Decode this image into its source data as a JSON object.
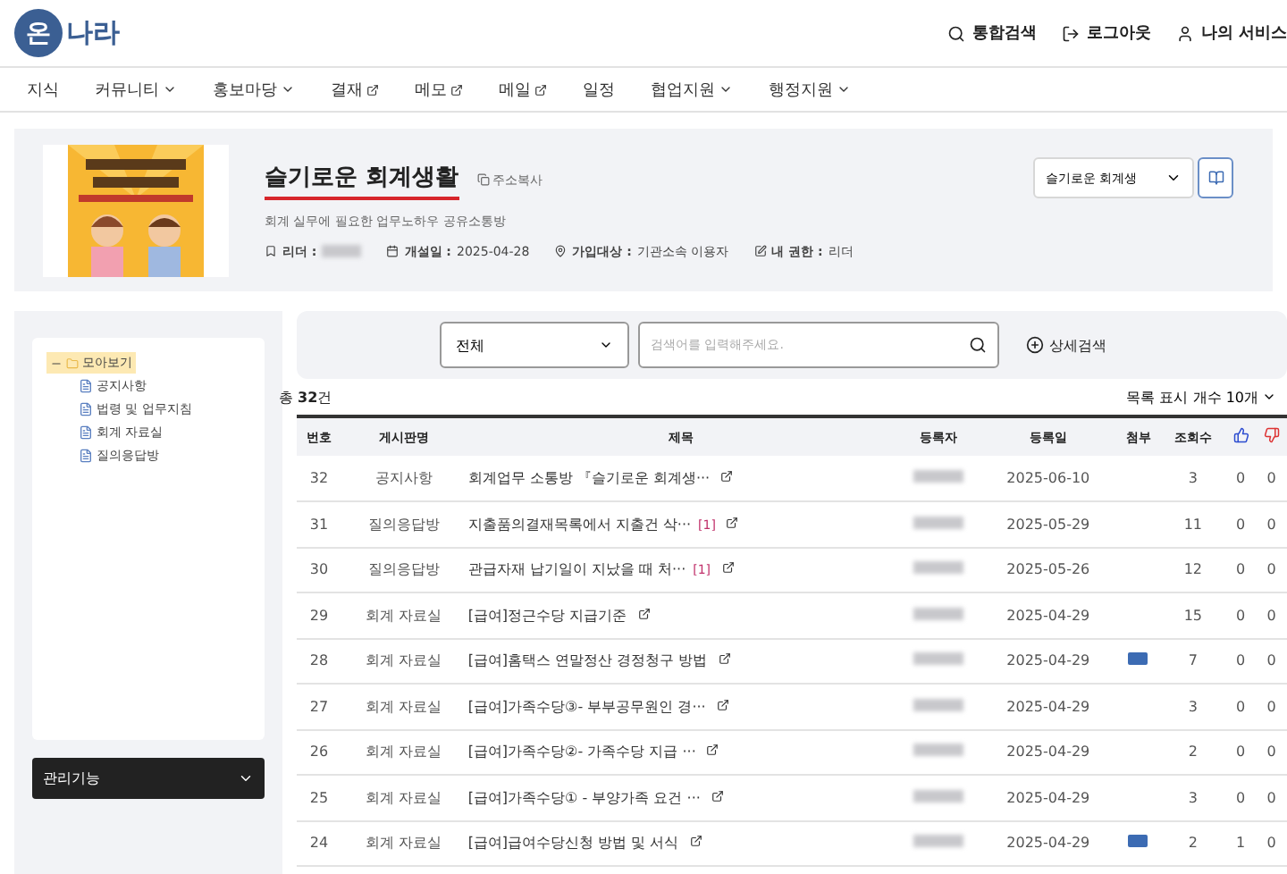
{
  "header": {
    "logo_mark": "온",
    "logo_text": "나라",
    "actions": [
      {
        "kind": "search",
        "label": "통합검색"
      },
      {
        "kind": "logout",
        "label": "로그아웃"
      },
      {
        "kind": "user",
        "label": "나의 서비스"
      }
    ]
  },
  "nav": [
    {
      "label": "지식",
      "kind": "plain"
    },
    {
      "label": "커뮤니티",
      "kind": "menu"
    },
    {
      "label": "홍보마당",
      "kind": "menu"
    },
    {
      "label": "결재",
      "kind": "external"
    },
    {
      "label": "메모",
      "kind": "external"
    },
    {
      "label": "메일",
      "kind": "external"
    },
    {
      "label": "일정",
      "kind": "plain"
    },
    {
      "label": "협업지원",
      "kind": "menu"
    },
    {
      "label": "행정지원",
      "kind": "menu"
    }
  ],
  "community": {
    "name": "슬기로운 회계생활",
    "copy_link": "주소복사",
    "description": "회계 실무에 필요한 업무노하우 공유소통방",
    "meta": [
      {
        "kind": "leader",
        "label": "리더 :",
        "blurred": true
      },
      {
        "kind": "date",
        "label": "개설일 :",
        "value": "2025-04-28",
        "blurred": false
      },
      {
        "kind": "target",
        "label": "가입대상 :",
        "value": "기관소속 이용자",
        "blurred": false
      },
      {
        "kind": "role",
        "label": "내 권한 :",
        "value": "리더",
        "blurred": false
      }
    ],
    "switcher": "슬기로운 회계생"
  },
  "sidebar": {
    "tree": [
      {
        "label": "모아보기",
        "expanded": true,
        "selected": true,
        "children": [
          {
            "label": "공지사항",
            "selected": false
          },
          {
            "label": "법령 및 업무지침",
            "selected": false
          },
          {
            "label": "회계 자료실",
            "selected": false
          },
          {
            "label": "질의응답방",
            "selected": false
          }
        ]
      }
    ],
    "admin": "관리기능"
  },
  "search": {
    "scope": "전체",
    "placeholder": "검색어를 입력해주세요.",
    "advanced": "상세검색"
  },
  "total": {
    "prefix": "총 ",
    "count": "32",
    "suffix": "건"
  },
  "page_size": "목록 표시 개수 10개",
  "table": {
    "columns": [
      "번호",
      "게시판명",
      "제목",
      "등록자",
      "등록일",
      "첨부",
      "조회수"
    ],
    "rows": [
      {
        "no": "32",
        "board": "공지사항",
        "title": "회계업무 소통방 『슬기로운 회계생···",
        "attachment": false,
        "date": "2025-06-10",
        "views": "3",
        "likes": "0",
        "dislikes": "0"
      },
      {
        "no": "31",
        "board": "질의응답방",
        "title": "지출품의결재목록에서 지출건 삭···",
        "comments": "[1]",
        "attachment": false,
        "date": "2025-05-29",
        "views": "11",
        "likes": "0",
        "dislikes": "0"
      },
      {
        "no": "30",
        "board": "질의응답방",
        "title": "관급자재 납기일이 지났을 때 처···",
        "comments": "[1]",
        "attachment": false,
        "date": "2025-05-26",
        "views": "12",
        "likes": "0",
        "dislikes": "0"
      },
      {
        "no": "29",
        "board": "회계 자료실",
        "title": "[급여]정근수당 지급기준",
        "attachment": false,
        "date": "2025-04-29",
        "views": "15",
        "likes": "0",
        "dislikes": "0"
      },
      {
        "no": "28",
        "board": "회계 자료실",
        "title": "[급여]홈택스 연말정산 경정청구 방법",
        "attachment": true,
        "date": "2025-04-29",
        "views": "7",
        "likes": "0",
        "dislikes": "0"
      },
      {
        "no": "27",
        "board": "회계 자료실",
        "title": "[급여]가족수당③- 부부공무원인 경···",
        "attachment": false,
        "date": "2025-04-29",
        "views": "3",
        "likes": "0",
        "dislikes": "0"
      },
      {
        "no": "26",
        "board": "회계 자료실",
        "title": "[급여]가족수당②- 가족수당 지급 ···",
        "attachment": false,
        "date": "2025-04-29",
        "views": "2",
        "likes": "0",
        "dislikes": "0"
      },
      {
        "no": "25",
        "board": "회계 자료실",
        "title": "[급여]가족수당① - 부양가족 요건 ···",
        "attachment": false,
        "date": "2025-04-29",
        "views": "3",
        "likes": "0",
        "dislikes": "0"
      },
      {
        "no": "24",
        "board": "회계 자료실",
        "title": "[급여]급여수당신청 방법 및 서식",
        "attachment": true,
        "date": "2025-04-29",
        "views": "2",
        "likes": "1",
        "dislikes": "0"
      }
    ]
  }
}
